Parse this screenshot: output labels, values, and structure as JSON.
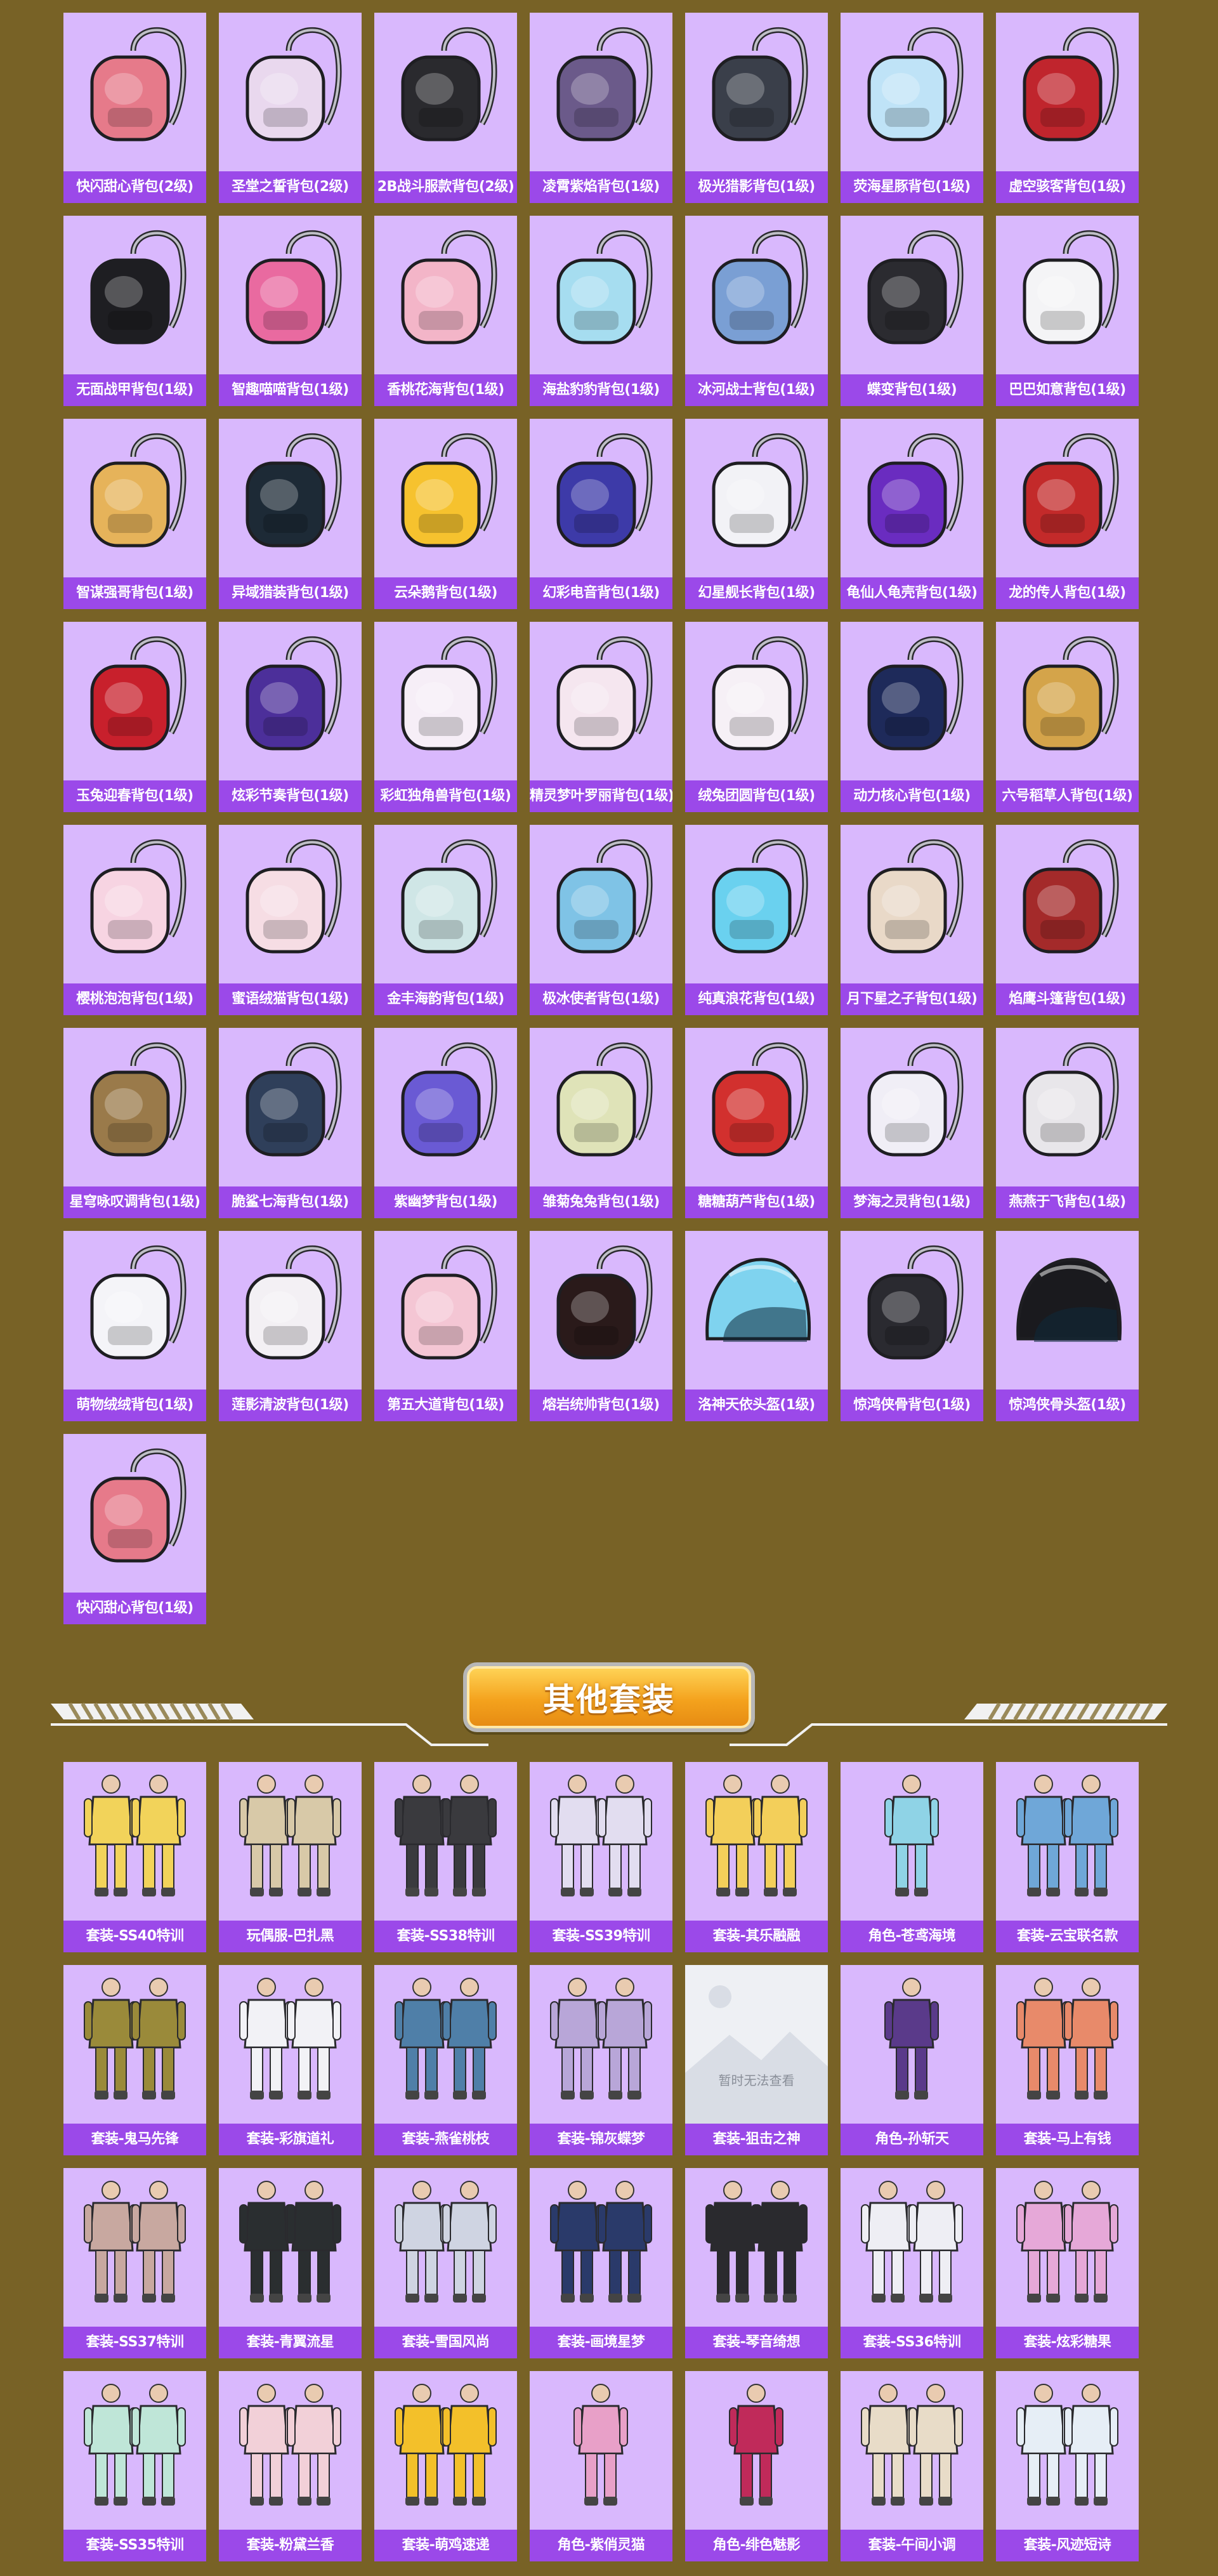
{
  "bags": [
    {
      "name": "快闪甜心背包(2级)",
      "color": "#e67a8a",
      "icon": "backpack-icon"
    },
    {
      "name": "圣堂之誓背包(2级)",
      "color": "#e9d8ee",
      "icon": "backpack-icon"
    },
    {
      "name": "2B战斗服款背包(2级)",
      "color": "#2a2a2e",
      "icon": "backpack-icon"
    },
    {
      "name": "凌霄紫焰背包(1级)",
      "color": "#6b5a8a",
      "icon": "backpack-icon"
    },
    {
      "name": "极光猎影背包(1级)",
      "color": "#3a3f4a",
      "icon": "backpack-icon"
    },
    {
      "name": "荧海星豚背包(1级)",
      "color": "#bfe3f7",
      "icon": "backpack-icon"
    },
    {
      "name": "虚空骇客背包(1级)",
      "color": "#c0252d",
      "icon": "backpack-icon"
    },
    {
      "name": "无面战甲背包(1级)",
      "color": "#1e1e22",
      "icon": "backpack-icon"
    },
    {
      "name": "智趣喵喵背包(1级)",
      "color": "#e96aa0",
      "icon": "backpack-icon"
    },
    {
      "name": "香桃花海背包(1级)",
      "color": "#f3b5c8",
      "icon": "backpack-icon"
    },
    {
      "name": "海盐豹豹背包(1级)",
      "color": "#a6ddf0",
      "icon": "backpack-icon"
    },
    {
      "name": "冰河战士背包(1级)",
      "color": "#7a9fd4",
      "icon": "backpack-icon"
    },
    {
      "name": "蝶变背包(1级)",
      "color": "#2b2b30",
      "icon": "backpack-icon"
    },
    {
      "name": "巴巴如意背包(1级)",
      "color": "#f4f4f6",
      "icon": "backpack-icon"
    },
    {
      "name": "智谋强哥背包(1级)",
      "color": "#e6b35a",
      "icon": "backpack-icon"
    },
    {
      "name": "异域猎装背包(1级)",
      "color": "#1d2a36",
      "icon": "backpack-icon"
    },
    {
      "name": "云朵鹅背包(1级)",
      "color": "#f6c22e",
      "icon": "backpack-icon"
    },
    {
      "name": "幻彩电音背包(1级)",
      "color": "#3d3aa8",
      "icon": "backpack-icon"
    },
    {
      "name": "幻星舰长背包(1级)",
      "color": "#f2f2f6",
      "icon": "backpack-icon"
    },
    {
      "name": "龟仙人龟壳背包(1级)",
      "color": "#6a2cc0",
      "icon": "backpack-icon"
    },
    {
      "name": "龙的传人背包(1级)",
      "color": "#c32a2a",
      "icon": "backpack-icon"
    },
    {
      "name": "玉兔迎春背包(1级)",
      "color": "#c8202c",
      "icon": "backpack-icon"
    },
    {
      "name": "炫彩节奏背包(1级)",
      "color": "#4c2f9a",
      "icon": "backpack-icon"
    },
    {
      "name": "彩虹独角兽背包(1级)",
      "color": "#f6eef7",
      "icon": "backpack-icon"
    },
    {
      "name": "精灵梦叶罗丽背包(1级)",
      "color": "#f5e6ef",
      "icon": "backpack-icon"
    },
    {
      "name": "绒兔团圆背包(1级)",
      "color": "#f6f0f6",
      "icon": "backpack-icon"
    },
    {
      "name": "动力核心背包(1级)",
      "color": "#1e2a5a",
      "icon": "backpack-icon"
    },
    {
      "name": "六号稻草人背包(1级)",
      "color": "#d4a44a",
      "icon": "backpack-icon"
    },
    {
      "name": "樱桃泡泡背包(1级)",
      "color": "#f7d4e2",
      "icon": "backpack-icon"
    },
    {
      "name": "蜜语绒猫背包(1级)",
      "color": "#f6dde4",
      "icon": "backpack-icon"
    },
    {
      "name": "金丰海韵背包(1级)",
      "color": "#cfe6e6",
      "icon": "backpack-icon"
    },
    {
      "name": "极冰使者背包(1级)",
      "color": "#7fc3e6",
      "icon": "backpack-icon"
    },
    {
      "name": "纯真浪花背包(1级)",
      "color": "#6ad1ef",
      "icon": "backpack-icon"
    },
    {
      "name": "月下星之子背包(1级)",
      "color": "#e9d9c8",
      "icon": "backpack-icon"
    },
    {
      "name": "焰鹰斗篷背包(1级)",
      "color": "#a42a2a",
      "icon": "backpack-icon"
    },
    {
      "name": "星穹咏叹调背包(1级)",
      "color": "#9a7a4a",
      "icon": "backpack-icon"
    },
    {
      "name": "脆鲨七海背包(1级)",
      "color": "#2f3f5a",
      "icon": "backpack-icon"
    },
    {
      "name": "紫幽梦背包(1级)",
      "color": "#6a5ad4",
      "icon": "backpack-icon"
    },
    {
      "name": "雏菊兔兔背包(1级)",
      "color": "#dfe3b8",
      "icon": "backpack-icon"
    },
    {
      "name": "糖糖葫芦背包(1级)",
      "color": "#d2302e",
      "icon": "backpack-icon"
    },
    {
      "name": "梦海之灵背包(1级)",
      "color": "#f0eef6",
      "icon": "backpack-icon"
    },
    {
      "name": "燕燕于飞背包(1级)",
      "color": "#e8e6ea",
      "icon": "backpack-icon"
    },
    {
      "name": "萌物绒绒背包(1级)",
      "color": "#f4f4f8",
      "icon": "backpack-icon"
    },
    {
      "name": "莲影清波背包(1级)",
      "color": "#f3f0f4",
      "icon": "backpack-icon"
    },
    {
      "name": "第五大道背包(1级)",
      "color": "#f4c6d4",
      "icon": "backpack-icon"
    },
    {
      "name": "熔岩统帅背包(1级)",
      "color": "#2a1a1a",
      "icon": "backpack-icon"
    },
    {
      "name": "洛神天依头盔(1级)",
      "color": "#7fd3ef",
      "icon": "helmet-icon"
    },
    {
      "name": "惊鸿侠骨背包(1级)",
      "color": "#2a2a30",
      "icon": "backpack-icon"
    },
    {
      "name": "惊鸿侠骨头盔(1级)",
      "color": "#1a1a1e",
      "icon": "helmet-icon"
    },
    {
      "name": "快闪甜心背包(1级)",
      "color": "#e67a8a",
      "icon": "backpack-icon"
    }
  ],
  "section_title": "其他套装",
  "outfits": [
    {
      "name": "套装-SS40特训",
      "color": "#f2d35a",
      "icon": "outfit-icon"
    },
    {
      "name": "玩偶服-巴扎黑",
      "color": "#d8c9a8",
      "icon": "mascot-suit-icon"
    },
    {
      "name": "套装-SS38特训",
      "color": "#3a3a3e",
      "icon": "outfit-icon"
    },
    {
      "name": "套装-SS39特训",
      "color": "#e2ddf0",
      "icon": "outfit-icon"
    },
    {
      "name": "套装-其乐融融",
      "color": "#f3cf5a",
      "icon": "outfit-icon"
    },
    {
      "name": "角色-苍鸢海境",
      "color": "#8fd3e6",
      "icon": "character-icon"
    },
    {
      "name": "套装-云宝联名款",
      "color": "#6fa7d8",
      "icon": "outfit-icon"
    },
    {
      "name": "套装-鬼马先锋",
      "color": "#9a8a3a",
      "icon": "outfit-icon"
    },
    {
      "name": "套装-彩旗道礼",
      "color": "#f2f2f6",
      "icon": "outfit-icon"
    },
    {
      "name": "套装-燕雀桃枝",
      "color": "#4f7fa8",
      "icon": "outfit-icon"
    },
    {
      "name": "套装-锦灰蝶梦",
      "color": "#b8a6d8",
      "icon": "outfit-icon"
    },
    {
      "name": "套装-狙击之神",
      "placeholder_text": "暂时无法查看",
      "color": "#eef0f4",
      "icon": "image-placeholder-icon",
      "placeholder": true
    },
    {
      "name": "角色-孙斩天",
      "color": "#5a3a8a",
      "icon": "character-icon"
    },
    {
      "name": "套装-马上有钱",
      "color": "#e88a6a",
      "icon": "outfit-icon"
    },
    {
      "name": "套装-SS37特训",
      "color": "#c8a8a0",
      "icon": "outfit-icon"
    },
    {
      "name": "套装-青翼流星",
      "color": "#2a2e30",
      "icon": "outfit-icon"
    },
    {
      "name": "套装-雪国风尚",
      "color": "#cfd4e2",
      "icon": "outfit-icon"
    },
    {
      "name": "套装-画境星梦",
      "color": "#2a3a6a",
      "icon": "outfit-icon"
    },
    {
      "name": "套装-琴音绮想",
      "color": "#2a2a2e",
      "icon": "outfit-icon"
    },
    {
      "name": "套装-SS36特训",
      "color": "#eeeef4",
      "icon": "outfit-icon"
    },
    {
      "name": "套装-炫彩糖果",
      "color": "#e6a8d8",
      "icon": "outfit-icon"
    },
    {
      "name": "套装-SS35特训",
      "color": "#bfe6d8",
      "icon": "outfit-icon"
    },
    {
      "name": "套装-粉黛兰香",
      "color": "#f2d0d8",
      "icon": "outfit-icon"
    },
    {
      "name": "套装-萌鸡速递",
      "color": "#f3c02a",
      "icon": "mascot-suit-icon"
    },
    {
      "name": "角色-紫俏灵猫",
      "color": "#e8a0c8",
      "icon": "character-icon"
    },
    {
      "name": "角色-绯色魅影",
      "color": "#c02a5a",
      "icon": "character-icon"
    },
    {
      "name": "套装-午间小调",
      "color": "#e8dcc8",
      "icon": "outfit-icon"
    },
    {
      "name": "套装-风迹短诗",
      "color": "#e6eef6",
      "icon": "outfit-icon"
    }
  ]
}
